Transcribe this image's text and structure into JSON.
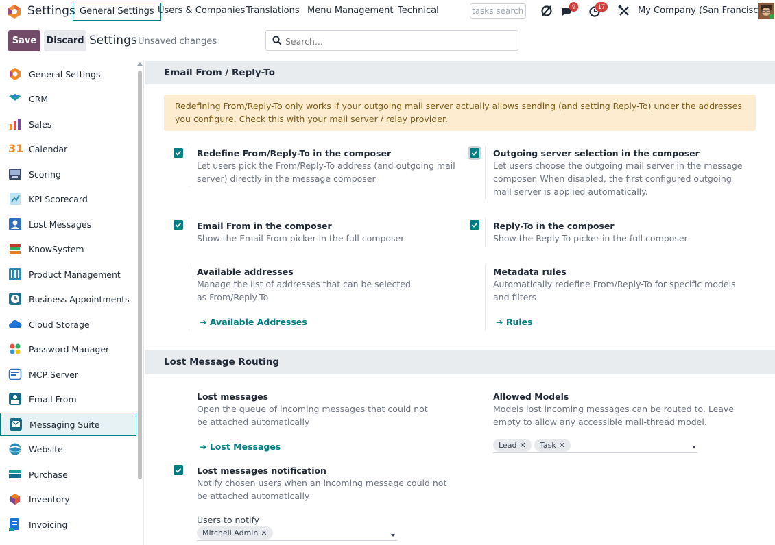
{
  "topbar": {
    "app_name": "Settings",
    "menus": [
      "General Settings",
      "Users & Companies",
      "Translations",
      "Menu Management",
      "Technical"
    ],
    "tasks_search_placeholder": "tasks search",
    "chat_badge": "9",
    "activity_badge": "17",
    "company": "My Company (San Francisco)",
    "brand_color": "#714b67",
    "accent_color": "#017e84"
  },
  "control": {
    "save_label": "Save",
    "discard_label": "Discard",
    "breadcrumb": "Settings",
    "unsaved": "Unsaved changes",
    "search_placeholder": "Search..."
  },
  "sidebar": {
    "items": [
      {
        "label": "General Settings",
        "icon": "general-settings-icon"
      },
      {
        "label": "CRM",
        "icon": "crm-icon"
      },
      {
        "label": "Sales",
        "icon": "sales-icon"
      },
      {
        "label": "Calendar",
        "icon": "calendar-icon",
        "glyph": "31"
      },
      {
        "label": "Scoring",
        "icon": "scoring-icon"
      },
      {
        "label": "KPI Scorecard",
        "icon": "kpi-icon"
      },
      {
        "label": "Lost Messages",
        "icon": "lost-messages-icon"
      },
      {
        "label": "KnowSystem",
        "icon": "knowsystem-icon"
      },
      {
        "label": "Product Management",
        "icon": "product-management-icon"
      },
      {
        "label": "Business Appointments",
        "icon": "appointments-icon"
      },
      {
        "label": "Cloud Storage",
        "icon": "cloud-icon"
      },
      {
        "label": "Password Manager",
        "icon": "password-icon"
      },
      {
        "label": "MCP Server",
        "icon": "mcp-icon"
      },
      {
        "label": "Email From",
        "icon": "email-from-icon"
      },
      {
        "label": "Messaging Suite",
        "icon": "messaging-icon",
        "active": true
      },
      {
        "label": "Website",
        "icon": "website-icon"
      },
      {
        "label": "Purchase",
        "icon": "purchase-icon"
      },
      {
        "label": "Inventory",
        "icon": "inventory-icon"
      },
      {
        "label": "Invoicing",
        "icon": "invoicing-icon"
      }
    ]
  },
  "sections": {
    "email_from": {
      "title": "Email From / Reply-To",
      "alert": "Redefining From/Reply-To only works if your outgoing mail server actually allows sending (and setting Reply-To) under the addresses you configure. Check this with your mail server / relay provider.",
      "redefine": {
        "title": "Redefine From/Reply-To in the composer",
        "desc": "Let users pick the From/Reply-To address (and outgoing mail server) directly in the message composer"
      },
      "outgoing": {
        "title": "Outgoing server selection in the composer",
        "desc": "Let users choose the outgoing mail server in the message composer. When disabled, the first configured outgoing mail server is applied automatically."
      },
      "email_from_picker": {
        "title": "Email From in the composer",
        "desc": "Show the Email From picker in the full composer"
      },
      "reply_to": {
        "title": "Reply-To in the composer",
        "desc": "Show the Reply-To picker in the full composer"
      },
      "available": {
        "title": "Available addresses",
        "desc": "Manage the list of addresses that can be selected as From/Reply-To",
        "link": "Available Addresses"
      },
      "metadata": {
        "title": "Metadata rules",
        "desc": "Automatically redefine From/Reply-To for specific models and filters",
        "link": "Rules"
      }
    },
    "lost": {
      "title": "Lost Message Routing",
      "lost_messages": {
        "title": "Lost messages",
        "desc": "Open the queue of incoming messages that could not be attached automatically",
        "link": "Lost Messages"
      },
      "allowed": {
        "title": "Allowed Models",
        "desc": "Models lost incoming messages can be routed to. Leave empty to allow any accessible mail-thread model.",
        "tags": [
          "Lead",
          "Task"
        ]
      },
      "notification": {
        "title": "Lost messages notification",
        "desc": "Notify chosen users when an incoming message could not be attached automatically"
      },
      "users": {
        "title": "Users to notify",
        "tags": [
          "Mitchell Admin"
        ]
      }
    }
  }
}
